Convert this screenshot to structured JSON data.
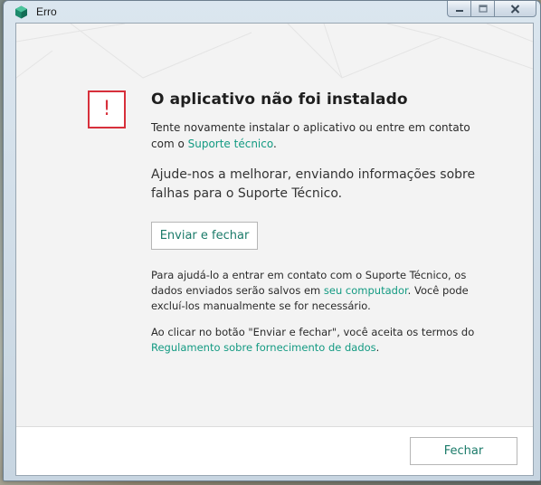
{
  "window": {
    "title": "Erro"
  },
  "content": {
    "heading": "O aplicativo não foi instalado",
    "message_text": "Tente novamente instalar o aplicativo ou entre em contato com o ",
    "message_link": "Suporte técnico",
    "message_end": ".",
    "help_text": "Ajude-nos a melhorar, enviando informações sobre falhas para o Suporte Técnico.",
    "send_button": "Enviar e fechar",
    "info_text_1": "Para ajudá-lo a entrar em contato com o Suporte Técnico, os dados enviados serão salvos em ",
    "info_link": "seu computador",
    "info_text_2": ". Você pode excluí-los manualmente se for necessário.",
    "terms_text": "Ao clicar no botão \"Enviar e fechar\", você aceita os termos do ",
    "terms_link": "Regulamento sobre fornecimento de dados",
    "terms_end": "."
  },
  "footer": {
    "close_button": "Fechar"
  },
  "colors": {
    "accent": "#139a82",
    "error": "#d7303b",
    "background": "#f3f3f3"
  },
  "icons": {
    "app": "kaspersky-shield-icon",
    "error": "exclamation-icon"
  }
}
